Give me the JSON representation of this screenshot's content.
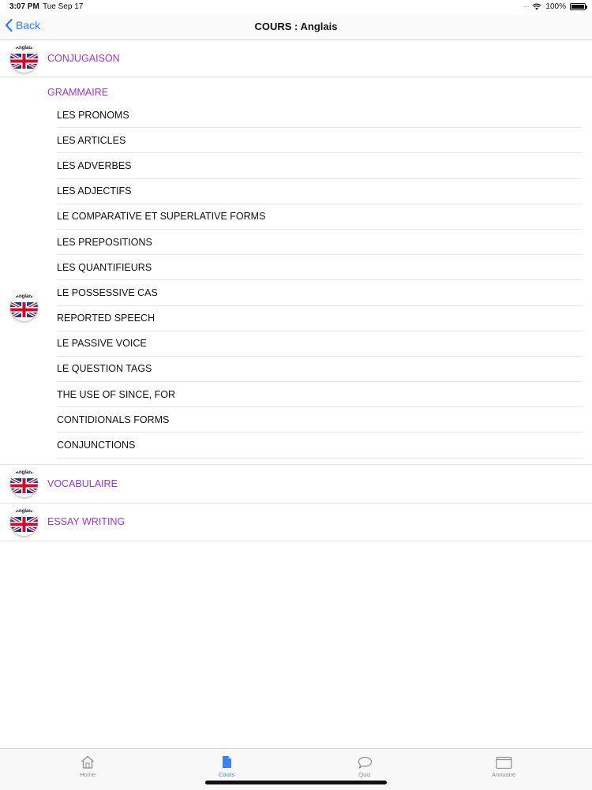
{
  "status_bar": {
    "time": "3:07 PM",
    "date": "Tue Sep 17",
    "battery": "100%"
  },
  "nav": {
    "back_label": "Back",
    "title": "COURS : Anglais"
  },
  "flag_caption": "Anglais",
  "sections": [
    {
      "label": "CONJUGAISON"
    },
    {
      "label": "GRAMMAIRE"
    },
    {
      "label": "VOCABULAIRE"
    },
    {
      "label": "ESSAY WRITING"
    }
  ],
  "grammar_items": [
    "LES PRONOMS",
    "LES ARTICLES",
    "LES ADVERBES",
    "LES ADJECTIFS",
    "LE COMPARATIVE ET SUPERLATIVE FORMS",
    "LES PREPOSITIONS",
    "LES QUANTIFIEURS",
    "LE POSSESSIVE CAS",
    "REPORTED SPEECH",
    "LE PASSIVE VOICE",
    "LE QUESTION TAGS",
    "THE USE OF SINCE, FOR",
    "CONTIDIONALS FORMS",
    "CONJUNCTIONS"
  ],
  "tabs": [
    {
      "label": "Home",
      "icon": "home-icon",
      "active": false
    },
    {
      "label": "Cours",
      "icon": "document-icon",
      "active": true
    },
    {
      "label": "Quiz",
      "icon": "chat-bubble-icon",
      "active": false
    },
    {
      "label": "Annuaire",
      "icon": "folder-icon",
      "active": false
    }
  ],
  "colors": {
    "accent": "#2f7bf5",
    "section": "#9b35c9",
    "tab_active": "#3b82f0"
  }
}
